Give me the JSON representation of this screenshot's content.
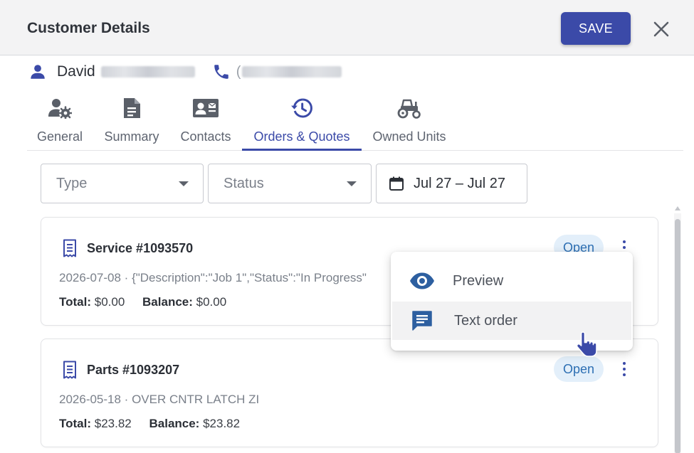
{
  "header": {
    "title": "Customer Details",
    "save_label": "SAVE"
  },
  "customer": {
    "first_name": "David",
    "phone_prefix": "("
  },
  "tabs": [
    {
      "label": "General",
      "icon": "user-gear-icon"
    },
    {
      "label": "Summary",
      "icon": "document-icon"
    },
    {
      "label": "Contacts",
      "icon": "contact-card-icon"
    },
    {
      "label": "Orders & Quotes",
      "icon": "history-icon"
    },
    {
      "label": "Owned Units",
      "icon": "tractor-icon"
    }
  ],
  "active_tab": "Orders & Quotes",
  "filters": {
    "type_placeholder": "Type",
    "status_placeholder": "Status",
    "date_range": "Jul 27 – Jul 27"
  },
  "orders": [
    {
      "title": "Service  #1093570",
      "subtitle": "2026-07-08 · {\"Description\":\"Job 1\",\"Status\":\"In Progress\"",
      "total_label": "Total:",
      "total_value": "$0.00",
      "balance_label": "Balance:",
      "balance_value": "$0.00",
      "status": "Open"
    },
    {
      "title": "Parts  #1093207",
      "subtitle": "2026-05-18 · OVER CNTR LATCH ZI",
      "total_label": "Total:",
      "total_value": "$23.82",
      "balance_label": "Balance:",
      "balance_value": "$23.82",
      "status": "Open"
    }
  ],
  "context_menu": {
    "items": [
      {
        "label": "Preview",
        "icon": "eye-icon"
      },
      {
        "label": "Text order",
        "icon": "message-icon"
      }
    ]
  },
  "colors": {
    "accent": "#3b4aa8",
    "badge_bg": "#e3effa",
    "badge_text": "#2d6fb3",
    "header_bg": "#f3f3f4"
  }
}
